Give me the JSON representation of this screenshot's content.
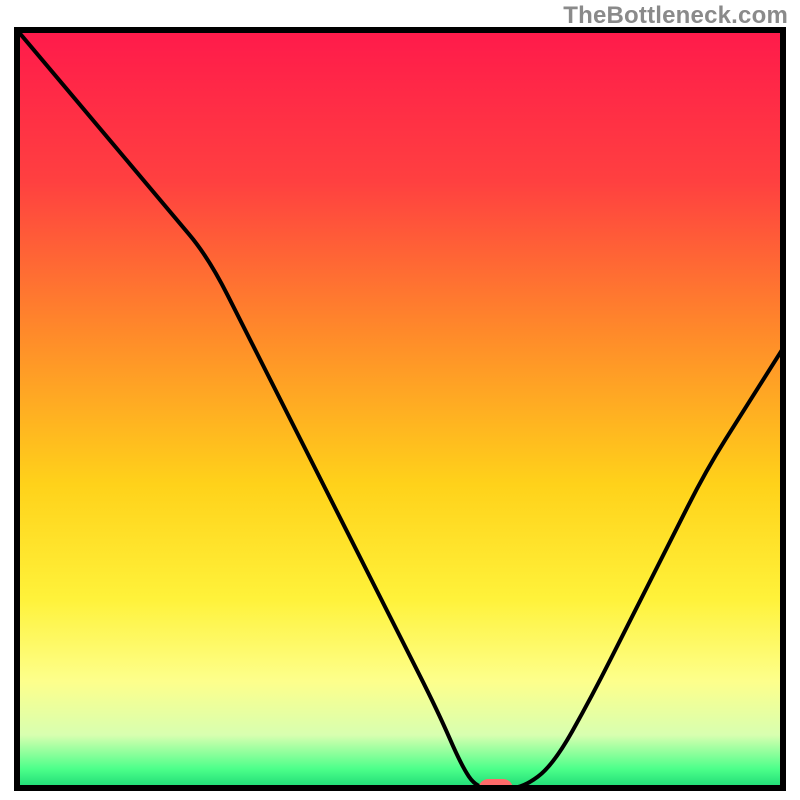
{
  "watermark": "TheBottleneck.com",
  "chart_data": {
    "type": "line",
    "title": "",
    "xlabel": "",
    "ylabel": "",
    "xlim": [
      0,
      100
    ],
    "ylim": [
      0,
      100
    ],
    "x": [
      0,
      5,
      10,
      15,
      20,
      25,
      30,
      35,
      40,
      45,
      50,
      55,
      58,
      60,
      63,
      66,
      70,
      75,
      80,
      85,
      90,
      95,
      100
    ],
    "values": [
      100,
      94,
      88,
      82,
      76,
      70,
      60,
      50,
      40,
      30,
      20,
      10,
      3,
      0,
      0,
      0,
      3,
      12,
      22,
      32,
      42,
      50,
      58
    ],
    "flat_segment_x": [
      60,
      66
    ],
    "marker": {
      "x": 62.5,
      "y": 0
    },
    "gradient_stops": [
      {
        "pos": 0.0,
        "color": "#ff1a4b"
      },
      {
        "pos": 0.2,
        "color": "#ff4040"
      },
      {
        "pos": 0.4,
        "color": "#ff8a2a"
      },
      {
        "pos": 0.6,
        "color": "#ffd21a"
      },
      {
        "pos": 0.75,
        "color": "#fff23a"
      },
      {
        "pos": 0.86,
        "color": "#fdff8c"
      },
      {
        "pos": 0.93,
        "color": "#d8ffb0"
      },
      {
        "pos": 0.975,
        "color": "#4cff8a"
      },
      {
        "pos": 1.0,
        "color": "#1cd975"
      }
    ],
    "frame": {
      "stroke": "#000000",
      "width": 6
    },
    "line_style": {
      "stroke": "#000000",
      "width": 4
    },
    "marker_style": {
      "fill": "#ff6a6a",
      "rx": 10,
      "w": 34,
      "h": 18
    }
  }
}
